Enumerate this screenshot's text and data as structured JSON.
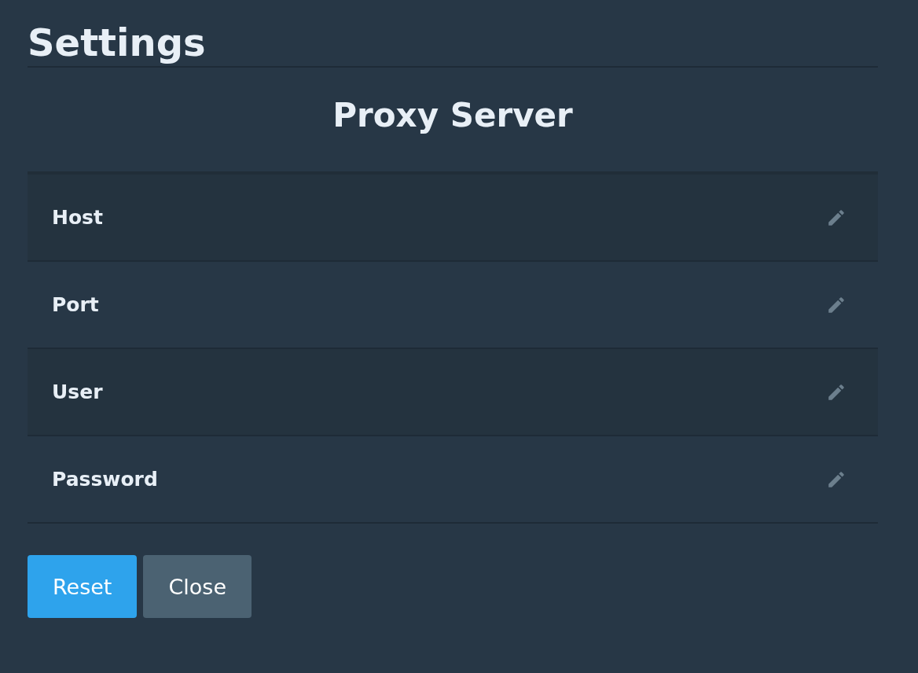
{
  "title": "Settings",
  "section": {
    "heading": "Proxy Server"
  },
  "fields": [
    {
      "label": "Host"
    },
    {
      "label": "Port"
    },
    {
      "label": "User"
    },
    {
      "label": "Password"
    }
  ],
  "buttons": [
    {
      "label": "Reset",
      "kind": "primary"
    },
    {
      "label": "Close",
      "kind": "secondary"
    }
  ]
}
